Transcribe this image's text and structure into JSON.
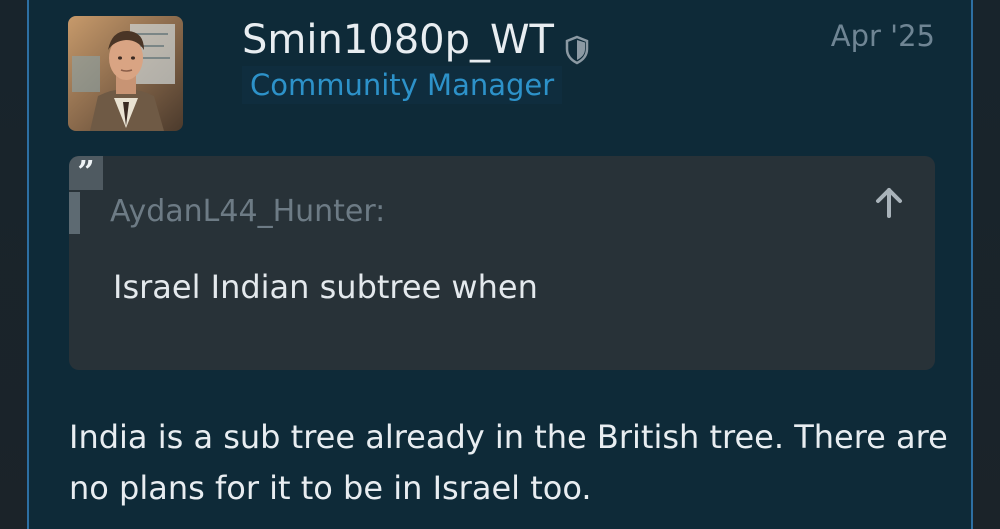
{
  "post": {
    "author": {
      "username": "Smin1080p_WT",
      "title": "Community Manager",
      "avatar_icon": "avatar-portrait",
      "badge_icon": "shield-icon"
    },
    "date": "Apr '25",
    "quote": {
      "author": "AydanL44_Hunter:",
      "text": "Israel Indian subtree when",
      "quote_icon_glyph": "”",
      "jump_icon": "arrow-up-icon"
    },
    "body": "India is a sub tree already in the British tree. There are no plans for it to be in Israel too."
  },
  "colors": {
    "post_background": "#0e2a38",
    "accent_border": "#2d6fa3",
    "username": "#e8edf1",
    "title": "#2d92c9",
    "date": "#6f8594",
    "quote_background": "#283238",
    "quote_author": "#6d7b85"
  }
}
